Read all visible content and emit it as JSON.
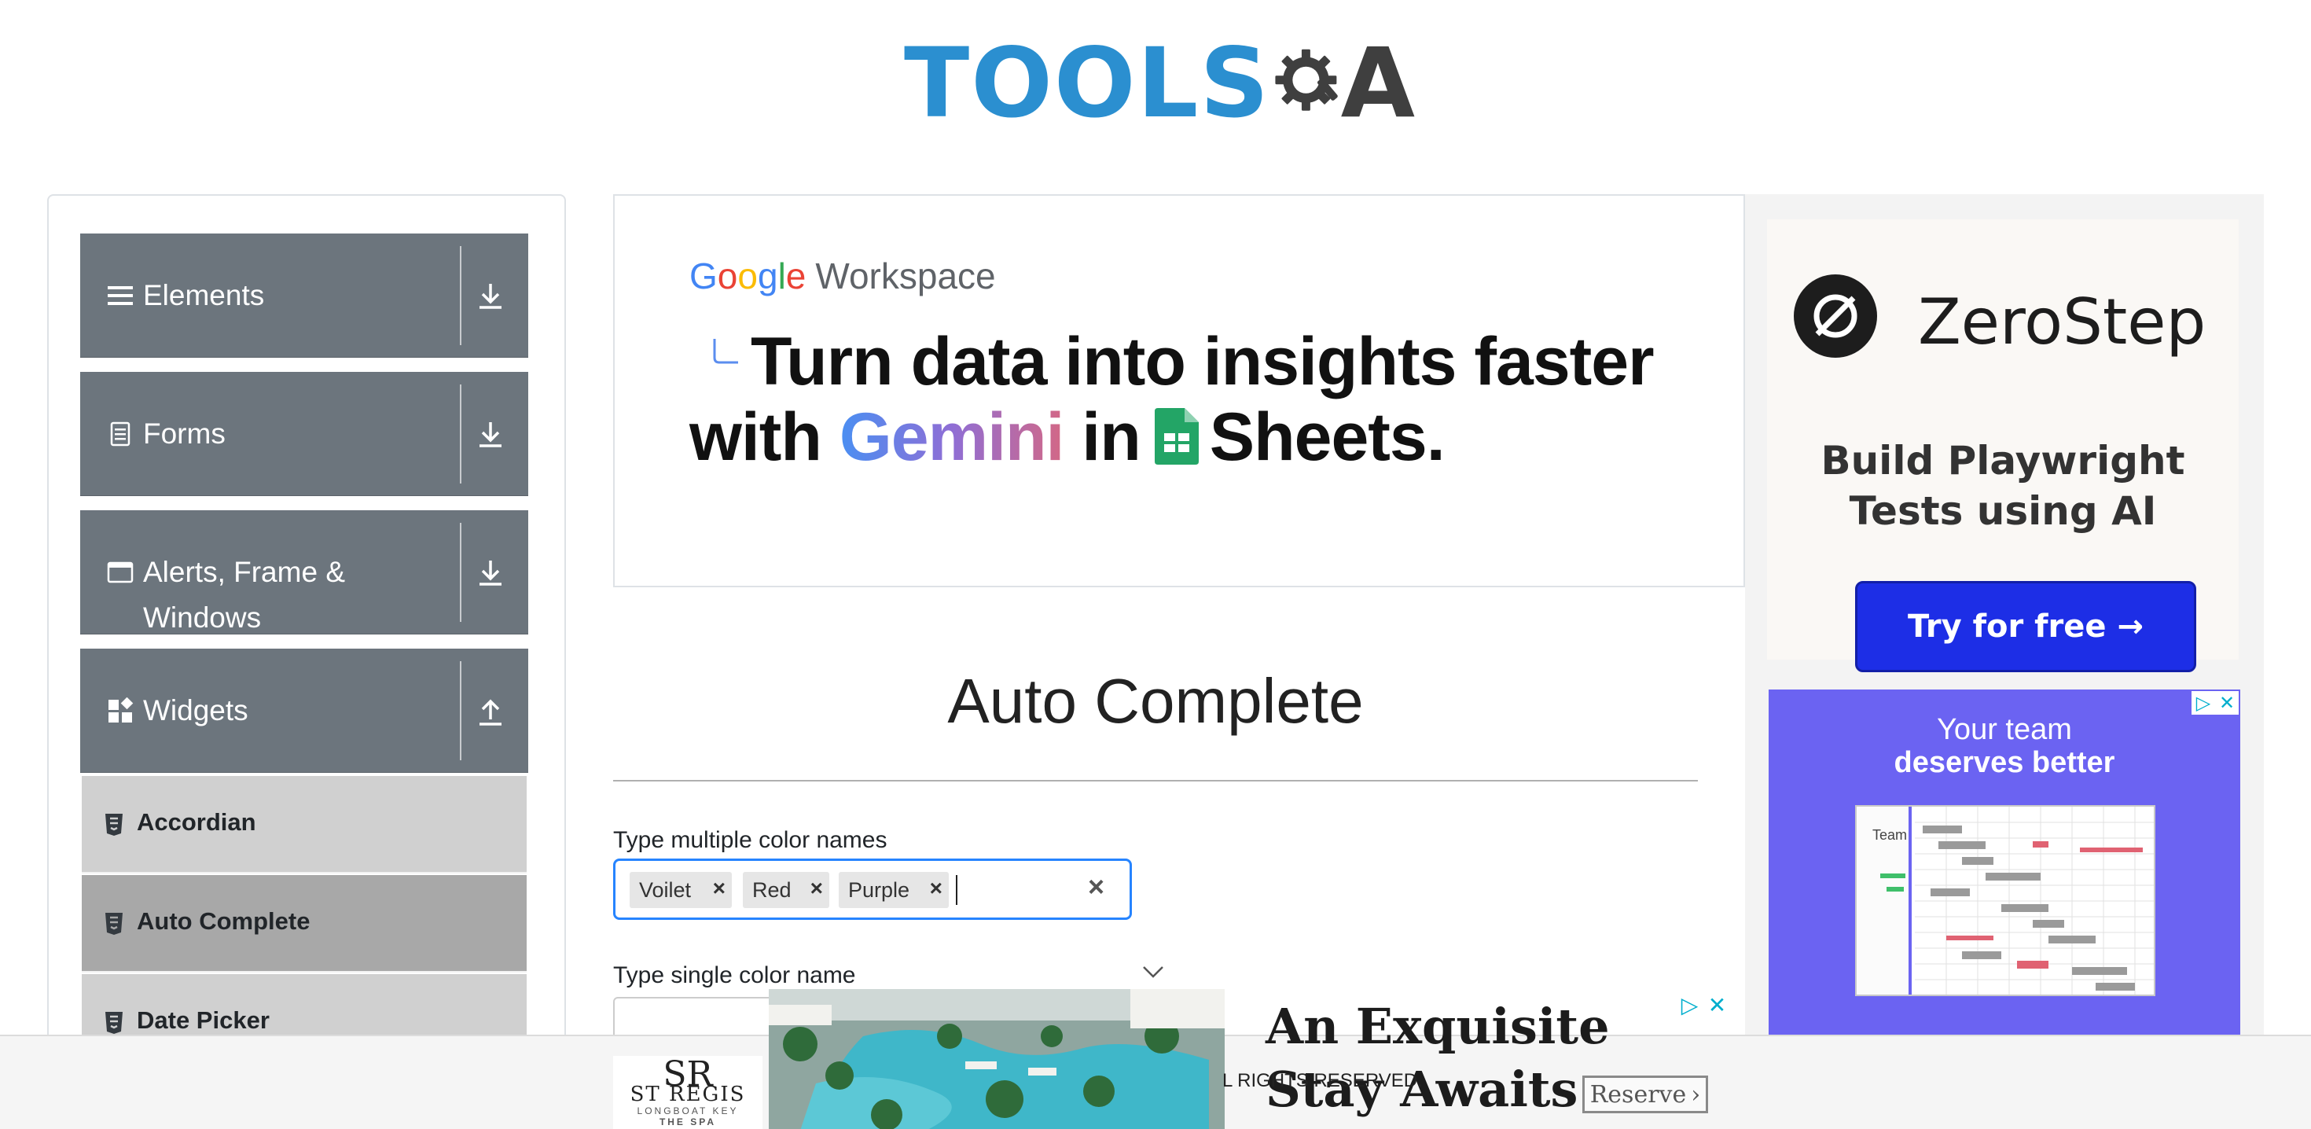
{
  "header": {
    "logo_text": "TOOLS",
    "logo_suffix": "A",
    "logo_icon": "gear-magnifier-icon"
  },
  "sidebar": {
    "groups": [
      {
        "label": "Elements",
        "icon": "hamburger-icon",
        "arrow": "download-arrow-icon"
      },
      {
        "label": "Forms",
        "icon": "document-icon",
        "arrow": "download-arrow-icon"
      },
      {
        "label": "Alerts, Frame &",
        "label_line2": "Windows",
        "icon": "browser-window-icon",
        "arrow": "download-arrow-icon"
      },
      {
        "label": "Widgets",
        "icon": "widgets-icon",
        "arrow": "upload-arrow-icon"
      }
    ],
    "items": [
      {
        "label": "Accordian",
        "active": false
      },
      {
        "label": "Auto Complete",
        "active": true
      },
      {
        "label": "Date Picker",
        "active": false
      }
    ]
  },
  "top_ad": {
    "brand_google": [
      "G",
      "o",
      "o",
      "g",
      "l",
      "e"
    ],
    "brand_workspace": "Workspace",
    "headline_line1": "Turn data into insights faster",
    "headline_with": "with",
    "headline_gemini": "Gemini",
    "headline_in": "in",
    "headline_sheets": "Sheets."
  },
  "right_ads": {
    "zerostep": {
      "name": "ZeroStep",
      "tagline_line1": "Build Playwright",
      "tagline_line2": "Tests using AI",
      "cta": "Try for free →"
    },
    "team": {
      "line1": "Your team",
      "line2": "deserves better",
      "mock_label": "Team"
    }
  },
  "main": {
    "title": "Auto Complete",
    "multi_label": "Type multiple color names",
    "chips": [
      "Voilet",
      "Red",
      "Purple"
    ],
    "chip_remove": "×",
    "clear": "×",
    "single_label": "Type single color name"
  },
  "footer": {
    "text": "L RIGHTS RESERVED."
  },
  "bottom_ad": {
    "logo_mark": "SR",
    "logo_name": "ST REGIS",
    "logo_location": "LONGBOAT KEY",
    "logo_sub": "THE SPA",
    "headline_line1": "An Exquisite",
    "headline_line2": "Stay Awaits",
    "cta": "Reserve",
    "cta_chevron": "›"
  },
  "colors": {
    "sidebar_group": "#6c757d",
    "sidebar_item": "#d0d0d0",
    "sidebar_item_active": "#a8a8a8",
    "input_focus": "#2684ff",
    "zerostep_button": "#1d2ee6",
    "team_ad": "#6b63f2",
    "logo_blue": "#2b8fd0"
  }
}
